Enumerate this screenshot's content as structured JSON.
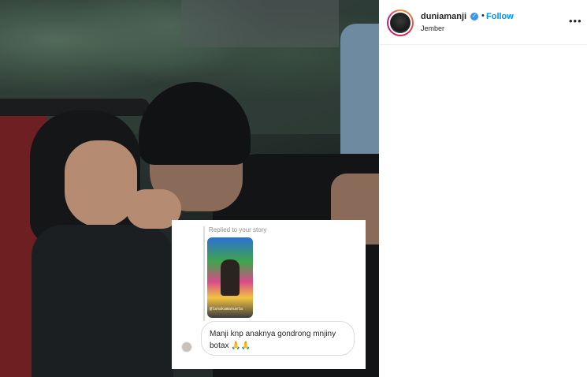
{
  "post": {
    "username": "duniamanji",
    "verified_icon": "verified-check-icon",
    "separator": "•",
    "follow_label": "Follow",
    "location": "Jember",
    "more_icon": "•••"
  },
  "story_reply": {
    "label": "Replied to your story",
    "story_tag": "@lanakamanuela",
    "message": "Manji knp anaknya gondrong mnjiny botax 🙏🙏"
  },
  "colors": {
    "follow": "#0095f6",
    "verified": "#3897f0"
  }
}
